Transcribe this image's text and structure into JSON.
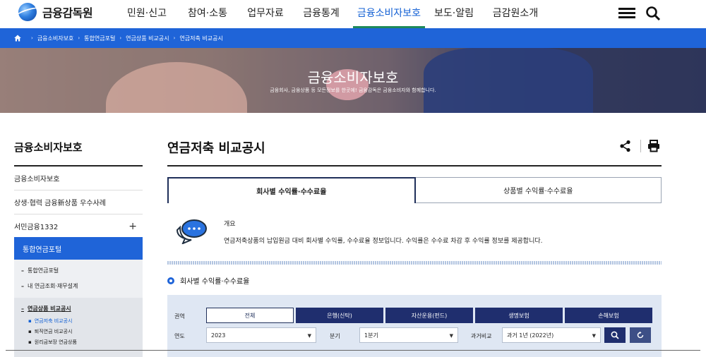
{
  "header": {
    "logo_text": "금융감독원",
    "nav": [
      {
        "label": "민원·신고",
        "active": false
      },
      {
        "label": "참여·소통",
        "active": false
      },
      {
        "label": "업무자료",
        "active": false
      },
      {
        "label": "금융통계",
        "active": false
      },
      {
        "label": "금융소비자보호",
        "active": true
      },
      {
        "label": "보도·알림",
        "active": false
      },
      {
        "label": "금감원소개",
        "active": false
      }
    ],
    "icons": {
      "menu": "hamburger-menu-icon",
      "search": "search-icon"
    }
  },
  "breadcrumb": {
    "items": [
      "금융소비자보호",
      "통합연금포털",
      "연금상품 비교공시",
      "연금저축 비교공시"
    ],
    "separator": "›"
  },
  "hero": {
    "title": "금융소비자보호",
    "subtitle": "금융회사, 금융상품 등 모든정보를 한곳에! 금융감독은 금융소비자와 함께합니다."
  },
  "lnb": {
    "title": "금융소비자보호",
    "items": [
      "금융소비자보호",
      "상생·협력 금융新상품 우수사례",
      "서민금융1332"
    ],
    "plus": "+",
    "sub_title": "통합연금포털",
    "links": [
      "통합연금포털",
      "내 연금조회·재무설계",
      "연금상품 비교공시"
    ],
    "leaves": [
      "연금저축 비교공시",
      "퇴직연금 비교공시",
      "원리금보장 연금상품"
    ]
  },
  "content": {
    "title": "연금저축 비교공시",
    "tabs": [
      {
        "label": "회사별 수익률·수수료율",
        "active": true
      },
      {
        "label": "상품별 수익률·수수료율",
        "active": false
      }
    ],
    "intro": {
      "heading": "개요",
      "text": "연금저축상품의 납입원금 대비 회사별 수익률, 수수료율 정보입니다. 수익률은 수수료 차감 후 수익률 정보를 제공합니다."
    },
    "section_heading": "회사별 수익률·수수료율",
    "filter": {
      "sector_label": "권역",
      "sectors": [
        {
          "label": "전체",
          "active": true
        },
        {
          "label": "은행(신탁)",
          "active": false
        },
        {
          "label": "자산운용(펀드)",
          "active": false
        },
        {
          "label": "생명보험",
          "active": false
        },
        {
          "label": "손해보험",
          "active": false
        }
      ],
      "year_label": "연도",
      "year_value": "2023",
      "quarter_label": "분기",
      "quarter_value": "1분기",
      "compare_label": "과거비교",
      "compare_value": "과거 1년 (2022년)"
    }
  },
  "colors": {
    "primary_blue": "#1f64d8",
    "navy": "#1f2e6e",
    "active_green": "#1e8a5a"
  }
}
